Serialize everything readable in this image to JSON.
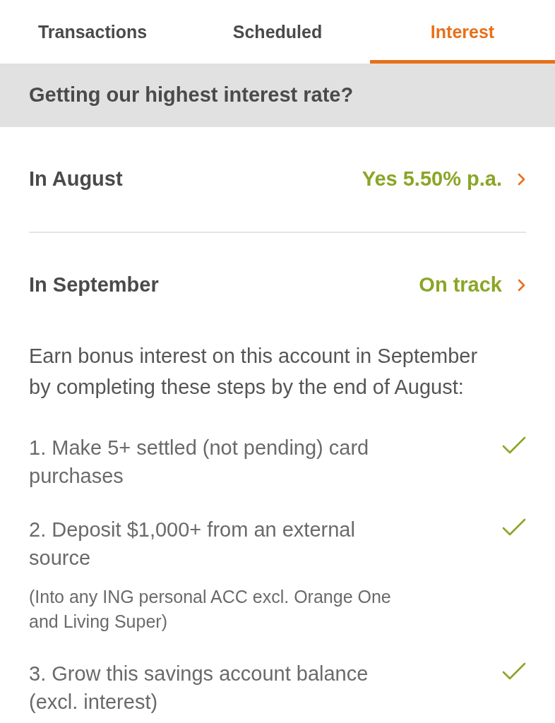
{
  "tabs": [
    {
      "label": "Transactions",
      "selected": false
    },
    {
      "label": "Scheduled",
      "selected": false
    },
    {
      "label": "Interest",
      "selected": true
    }
  ],
  "section_header": {
    "title": "Getting our highest interest rate?"
  },
  "months": [
    {
      "label": "In August",
      "status": "Yes 5.50% p.a."
    },
    {
      "label": "In September",
      "status": "On track"
    }
  ],
  "intro": "Earn bonus interest on this account in September by completing these steps by the end of August:",
  "steps": [
    {
      "text": "1. Make 5+ settled (not pending) card purchases",
      "checked": true
    },
    {
      "text": "2. Deposit $1,000+ from an external source",
      "note": "(Into any ING personal ACC excl. Orange One and Living Super)",
      "checked": true
    },
    {
      "text": "3. Grow this savings account balance (excl. interest)",
      "checked": true
    }
  ]
}
